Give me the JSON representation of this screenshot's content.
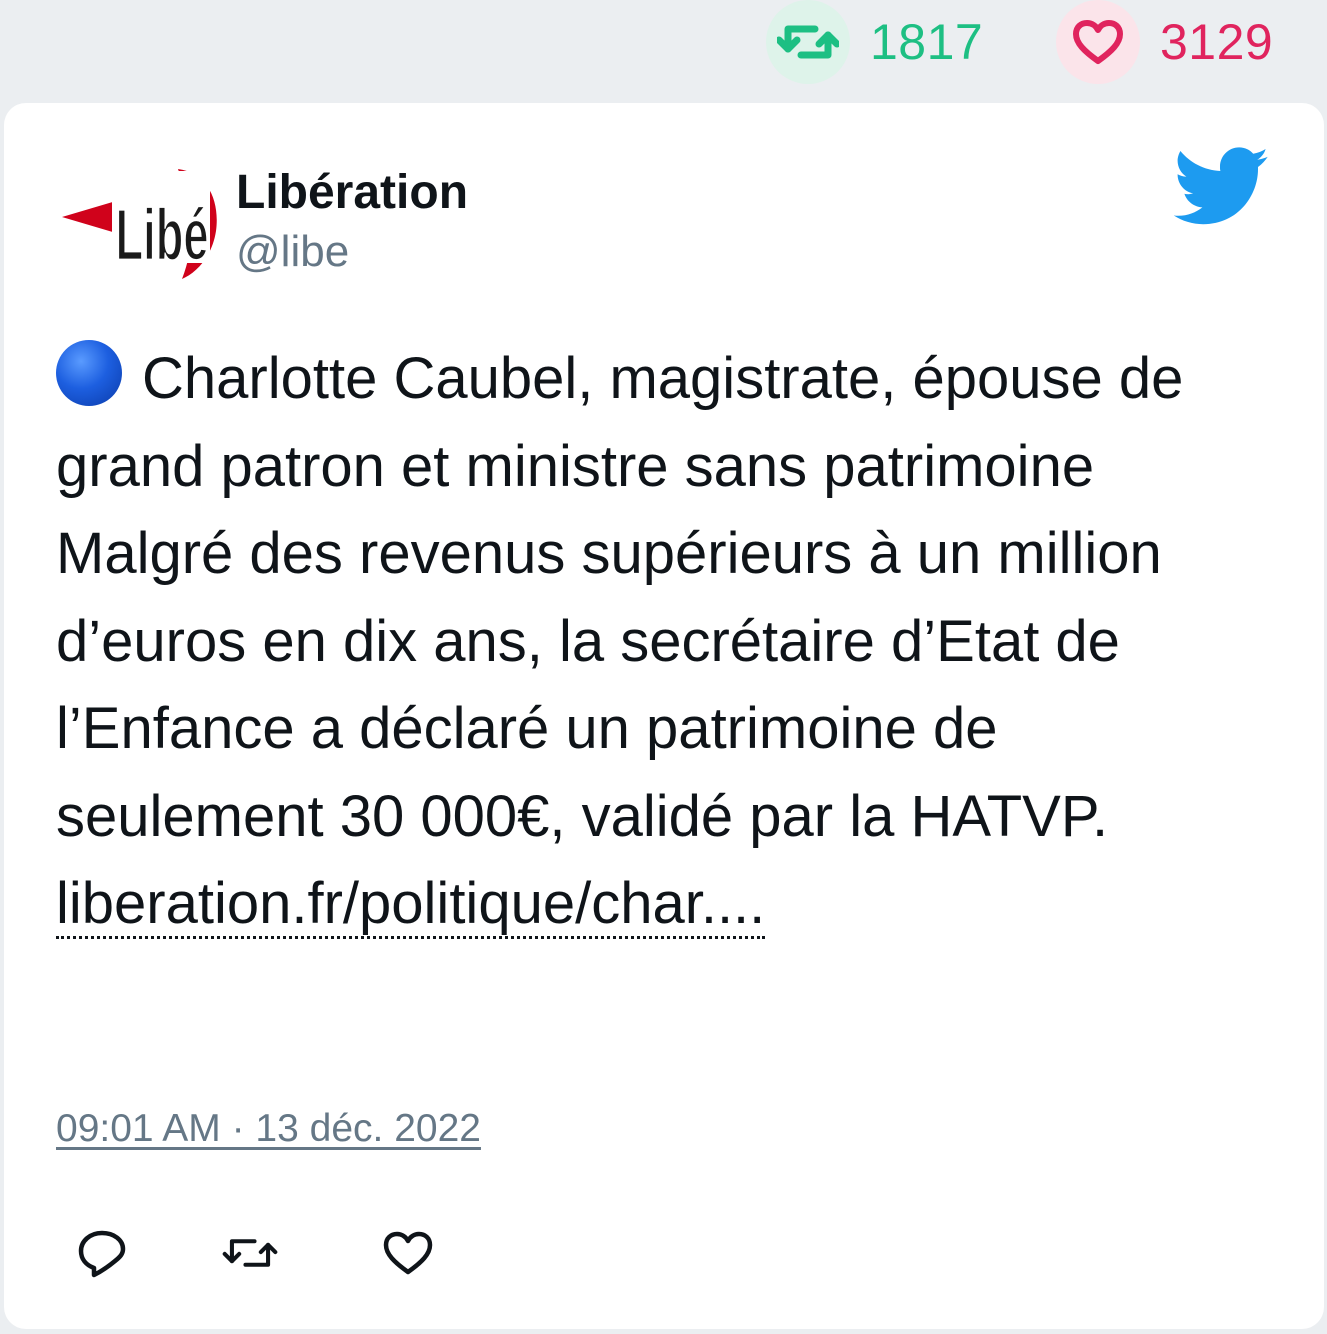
{
  "top_stats": {
    "retweets": "1817",
    "likes": "3129",
    "retweet_color": "#1dbf83",
    "like_color": "#e0245e"
  },
  "tweet": {
    "author": {
      "name": "Libération",
      "handle": "@libe",
      "avatar_logo_text": "Libé"
    },
    "text_emoji": "blue-circle",
    "text": "Charlotte Caubel, magistrate, épouse de grand patron et ministre sans patrimoine Malgré des revenus supérieurs à un million d’euros en dix ans, la secrétaire d’Etat de l’Enfance a déclaré un patrimoine de seulement 30 000€, validé par la HATVP.",
    "link_text": "liberation.fr/politique/char....",
    "timestamp": "09:01 AM · 13 déc. 2022"
  },
  "icons": {
    "brand": "twitter-bird-icon",
    "actions": [
      "reply-icon",
      "retweet-icon",
      "like-icon"
    ]
  },
  "colors": {
    "twitter_blue": "#1d9bf0",
    "muted_text": "#657786",
    "body_text": "#0f1419"
  }
}
